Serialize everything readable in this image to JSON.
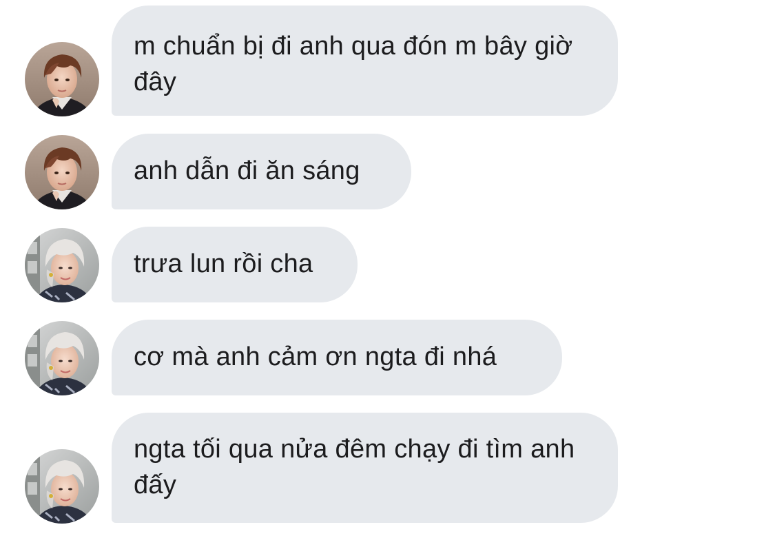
{
  "messages": [
    {
      "text": "m chuẩn bị đi anh qua đón m bây giờ đây",
      "sender": "brown-hair-avatar"
    },
    {
      "text": "anh dẫn đi ăn sáng",
      "sender": "brown-hair-avatar"
    },
    {
      "text": "trưa lun rồi cha",
      "sender": "silver-hair-avatar"
    },
    {
      "text": "cơ mà anh cảm ơn ngta đi nhá",
      "sender": "silver-hair-avatar"
    },
    {
      "text": "ngta tối qua nửa đêm chạy đi tìm anh đấy",
      "sender": "silver-hair-avatar"
    }
  ],
  "colors": {
    "bubble_bg": "#e6e9ed",
    "text": "#1c1c1e",
    "background": "#ffffff"
  }
}
